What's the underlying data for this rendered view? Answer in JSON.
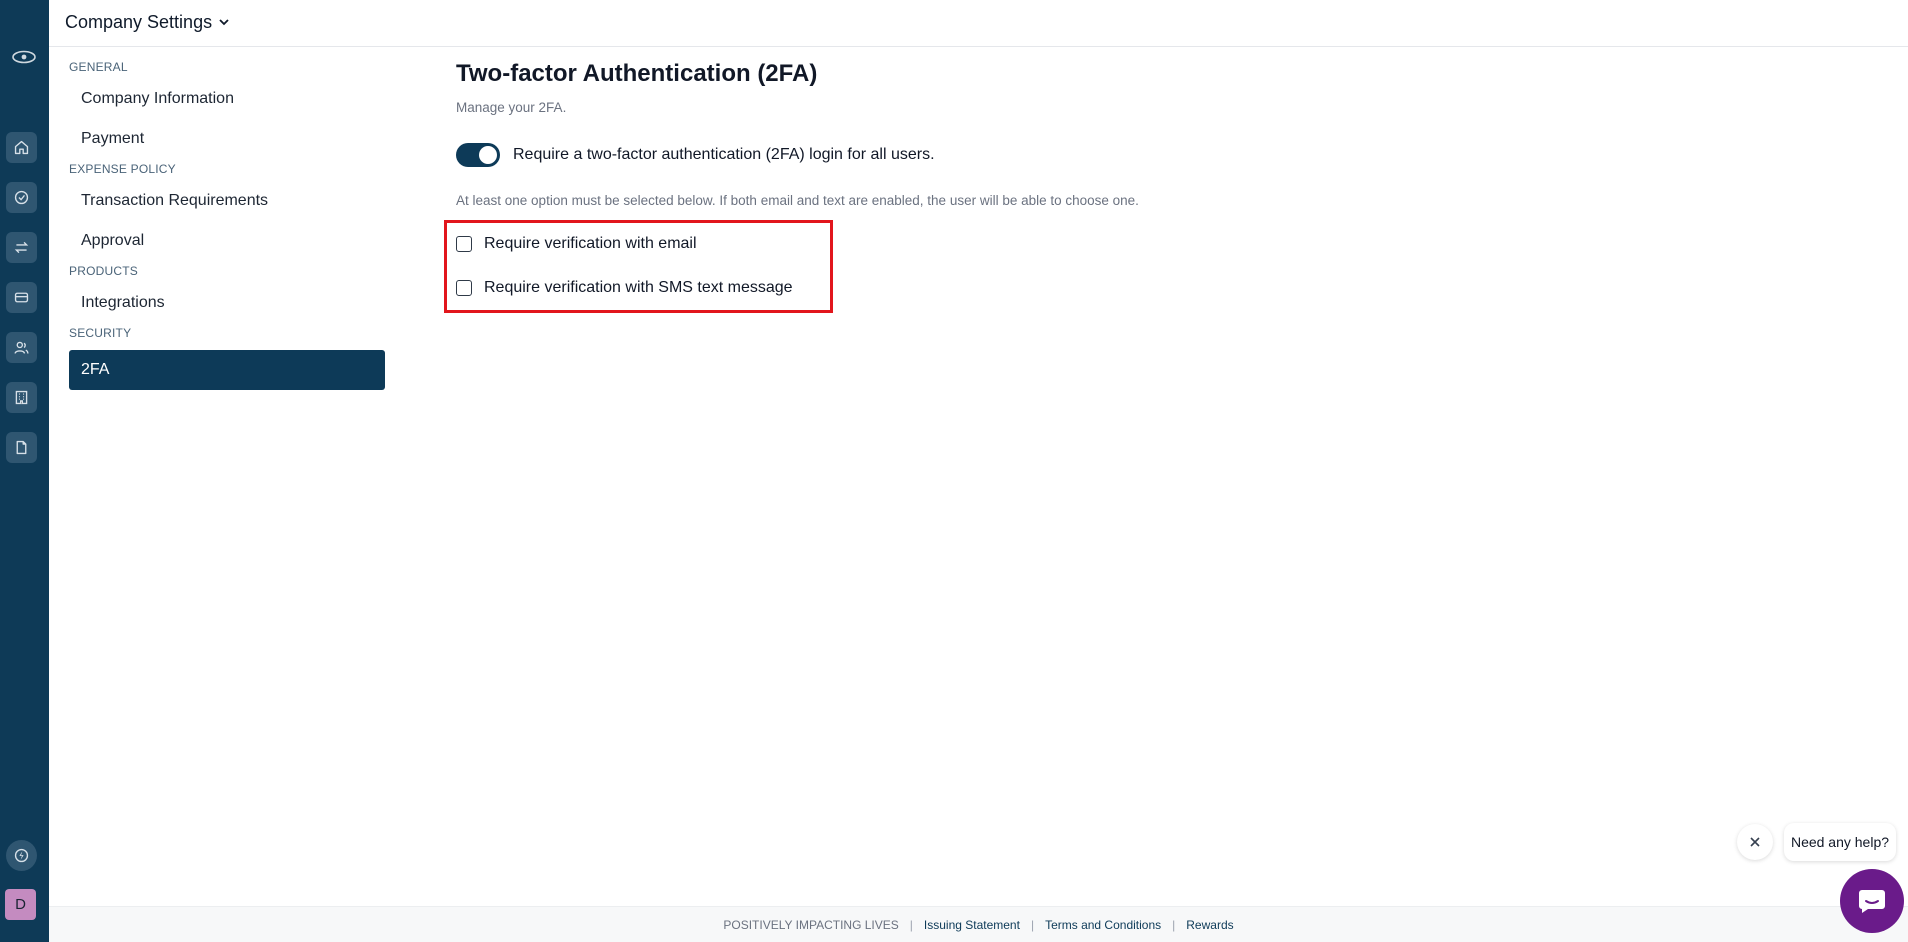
{
  "header": {
    "title": "Company Settings"
  },
  "rail": {
    "icons": [
      "eye-logo-icon",
      "home-icon",
      "check-circle-icon",
      "transfer-icon",
      "card-icon",
      "users-icon",
      "building-icon",
      "document-icon",
      "bolt-icon"
    ],
    "avatar": "D"
  },
  "sidebar": {
    "sections": [
      {
        "label": "GENERAL",
        "items": [
          "Company Information",
          "Payment"
        ]
      },
      {
        "label": "EXPENSE POLICY",
        "items": [
          "Transaction Requirements",
          "Approval"
        ]
      },
      {
        "label": "PRODUCTS",
        "items": [
          "Integrations"
        ]
      },
      {
        "label": "SECURITY",
        "items": [
          "2FA"
        ]
      }
    ],
    "active": "2FA"
  },
  "main": {
    "title": "Two-factor Authentication (2FA)",
    "subtitle": "Manage your 2FA.",
    "toggle_label": "Require a two-factor authentication (2FA) login for all users.",
    "toggle_on": true,
    "hint": "At least one option must be selected below. If both email and text are enabled, the user will be able to choose one.",
    "options": [
      {
        "label": "Require verification with email",
        "checked": false
      },
      {
        "label": "Require verification with SMS text message",
        "checked": false
      }
    ]
  },
  "footer": {
    "brand": "POSITIVELY IMPACTING LIVES",
    "links": [
      "Issuing Statement",
      "Terms and Conditions",
      "Rewards"
    ]
  },
  "help": {
    "bubble": "Need any help?"
  },
  "colors": {
    "navy": "#0e3a57",
    "accent": "#0d3a58",
    "highlight": "#e2161c",
    "chat": "#6a1b8a"
  }
}
